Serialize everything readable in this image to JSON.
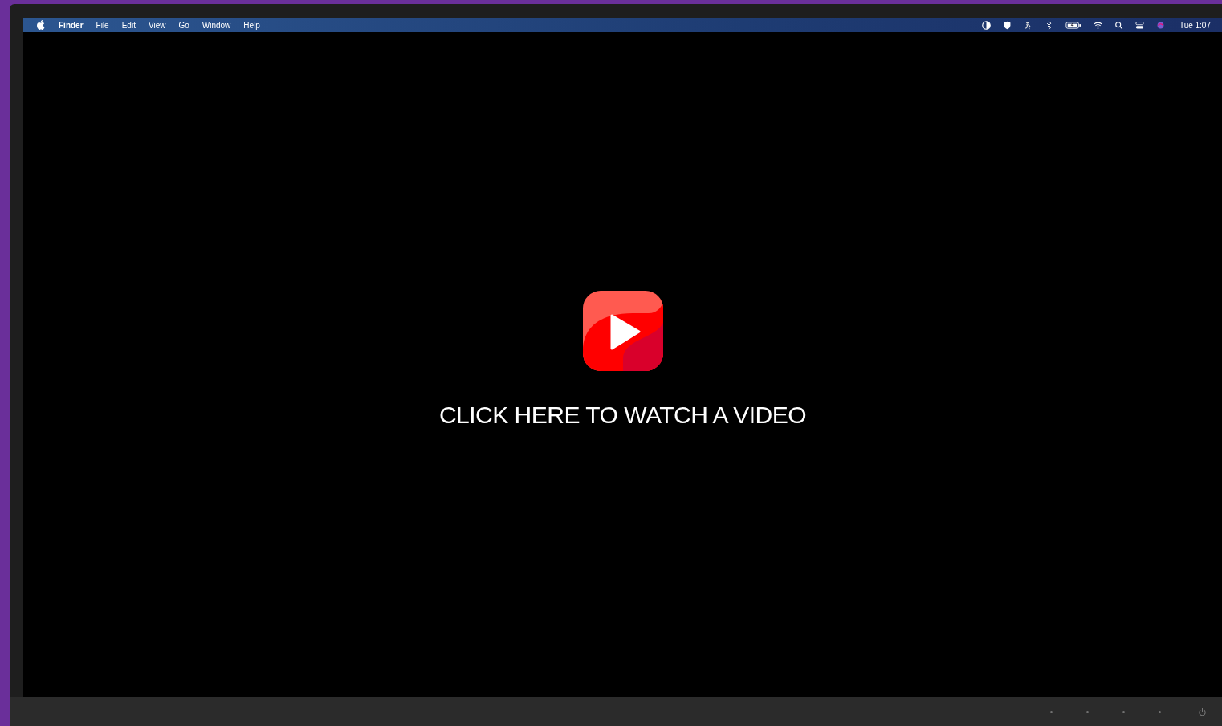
{
  "menu_bar": {
    "app_name": "Finder",
    "menus": [
      "File",
      "Edit",
      "View",
      "Go",
      "Window",
      "Help"
    ],
    "clock": "Tue 1:07"
  },
  "video_prompt": {
    "text": "CLICK HERE TO WATCH A VIDEO"
  }
}
